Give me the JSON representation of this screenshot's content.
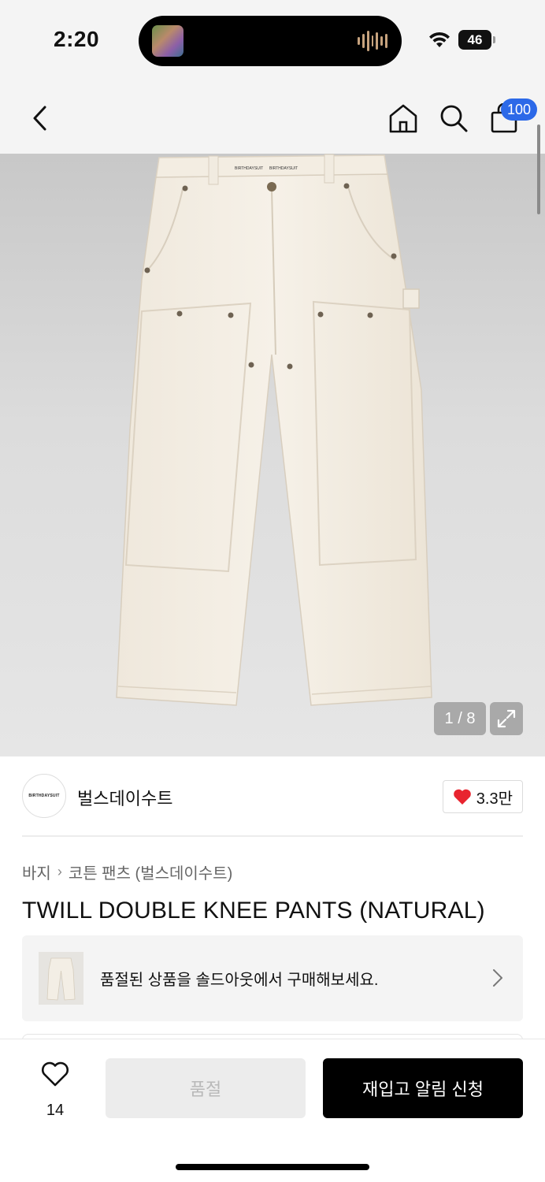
{
  "status_bar": {
    "time": "2:20",
    "battery": "46"
  },
  "nav": {
    "cart_badge": "100"
  },
  "gallery": {
    "counter": "1 / 8",
    "garment_label": "BIRTHDAYSUIT"
  },
  "brand": {
    "logo_text": "BIRTHDAYSUIT",
    "name": "벌스데이수트",
    "likes": "3.3만"
  },
  "breadcrumb": {
    "category": "바지",
    "subcategory": "코튼 팬츠 (벌스데이수트)"
  },
  "product": {
    "title": "TWILL DOUBLE KNEE PANTS (NATURAL)"
  },
  "soldout_banner": {
    "text": "품절된 상품을 솔드아웃에서 구매해보세요."
  },
  "bottom_bar": {
    "wish_count": "14",
    "soldout_label": "품절",
    "notify_label": "재입고 알림 신청"
  },
  "colors": {
    "badge_blue": "#2c69e8",
    "heart_red": "#e8242f",
    "primary_black": "#000000"
  }
}
